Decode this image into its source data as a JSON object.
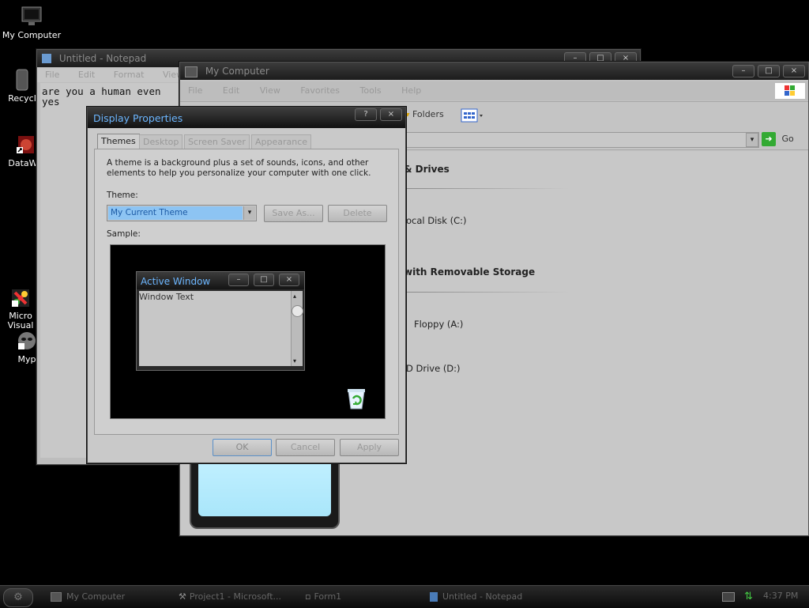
{
  "desktop": {
    "icons": [
      {
        "label": "My Computer"
      },
      {
        "label": "Recycl"
      },
      {
        "label": "DataWa"
      },
      {
        "label": "Micro\nVisual"
      },
      {
        "label": "Myp"
      }
    ]
  },
  "notepad": {
    "title": "Untitled - Notepad",
    "menu": [
      "File",
      "Edit",
      "Format",
      "View"
    ],
    "text": "are you a human even\nyes"
  },
  "mycomputer": {
    "title": "My Computer",
    "menu": [
      "File",
      "Edit",
      "View",
      "Favorites",
      "Tools",
      "Help"
    ],
    "toolbar_folders": "Folders",
    "go_label": "Go",
    "sections": [
      {
        "title": "Hard Disk Drives",
        "shown": "& Drives"
      },
      {
        "title": "with Removable Storage"
      }
    ],
    "items": [
      "ocal Disk (C:)",
      "Floppy (A:)",
      "D Drive (D:)"
    ]
  },
  "displayprops": {
    "title": "Display Properties",
    "tabs": [
      "Themes",
      "Desktop",
      "Screen Saver",
      "Appearance"
    ],
    "description": "A theme is a background plus a set of sounds, icons, and other elements to help you personalize your computer with one click.",
    "theme_label": "Theme:",
    "theme_value": "My Current Theme",
    "save_as": "Save As...",
    "delete": "Delete",
    "sample_label": "Sample:",
    "sample_window_title": "Active Window",
    "sample_window_text": "Window Text",
    "ok": "OK",
    "cancel": "Cancel",
    "apply": "Apply"
  },
  "taskbar": {
    "items": [
      "My Computer",
      "Project1 - Microsoft...",
      "Form1",
      "Untitled - Notepad"
    ],
    "clock": "4:37 PM"
  }
}
